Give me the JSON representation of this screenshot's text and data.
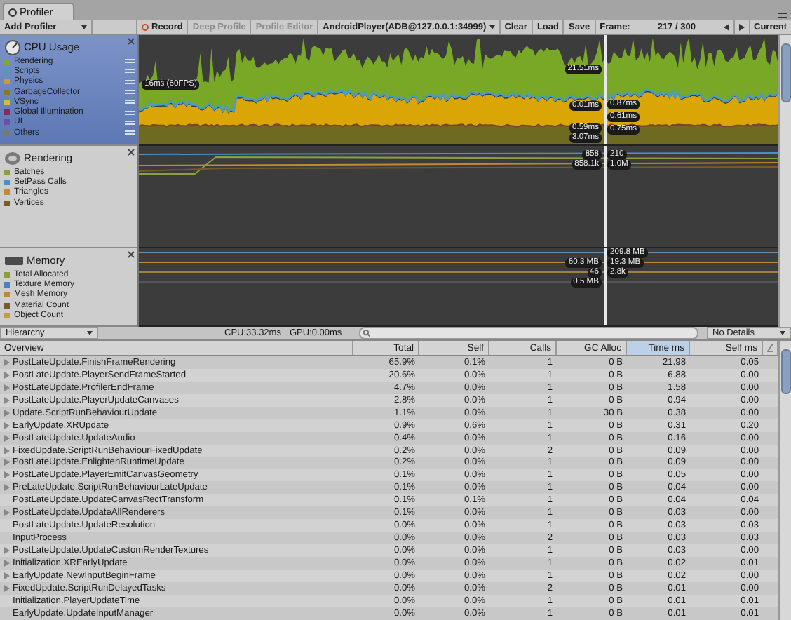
{
  "window": {
    "tab": "Profiler"
  },
  "toolbar": {
    "add_profiler": "Add Profiler",
    "buttons": [
      {
        "label": "Record",
        "kind": "record",
        "disabled": false
      },
      {
        "label": "Deep Profile",
        "kind": "plain",
        "disabled": true
      },
      {
        "label": "Profile Editor",
        "kind": "plain",
        "disabled": true
      }
    ],
    "target": "AndroidPlayer(ADB@127.0.0.1:34999)",
    "file_buttons": [
      "Clear",
      "Load",
      "Save"
    ],
    "frame_label": "Frame:",
    "frame": "217 / 300",
    "current": "Current"
  },
  "modules": [
    {
      "title": "CPU Usage",
      "kind": "cpu",
      "selected": true,
      "items": [
        {
          "label": "Rendering",
          "color": "#7fa830"
        },
        {
          "label": "Scripts",
          "color": "#4a9bc6"
        },
        {
          "label": "Physics",
          "color": "#d09a30"
        },
        {
          "label": "GarbageCollector",
          "color": "#8a7438"
        },
        {
          "label": "VSync",
          "color": "#c8c040"
        },
        {
          "label": "Global Illumination",
          "color": "#8a2a5a"
        },
        {
          "label": "UI",
          "color": "#6a50a8"
        },
        {
          "label": "Others",
          "color": "#7a7a6a"
        }
      ],
      "readouts": [
        "16ms (60FPS)",
        "21.51ms",
        "0.01ms",
        "0.87ms",
        "0.61ms",
        "0.59ms",
        "0.75ms",
        "3.07ms"
      ]
    },
    {
      "title": "Rendering",
      "kind": "rendering",
      "selected": false,
      "items": [
        {
          "label": "Batches",
          "color": "#8aa040"
        },
        {
          "label": "SetPass Calls",
          "color": "#4a90c0"
        },
        {
          "label": "Triangles",
          "color": "#c08a30"
        },
        {
          "label": "Vertices",
          "color": "#7a5a28"
        }
      ],
      "readouts": [
        "858",
        "210",
        "858.1k",
        "1.0M"
      ]
    },
    {
      "title": "Memory",
      "kind": "memory",
      "selected": false,
      "items": [
        {
          "label": "Total Allocated",
          "color": "#8aa040"
        },
        {
          "label": "Texture Memory",
          "color": "#4a80c0"
        },
        {
          "label": "Mesh Memory",
          "color": "#c08a30"
        },
        {
          "label": "Material Count",
          "color": "#7a5a28"
        },
        {
          "label": "Object Count",
          "color": "#c0a040"
        }
      ],
      "readouts": [
        "209.8 MB",
        "60.3 MB",
        "19.3 MB",
        "46",
        "2.8k",
        "0.5 MB"
      ]
    }
  ],
  "details_bar": {
    "view": "Hierarchy",
    "stats": [
      "CPU:33.32ms",
      "GPU:0.00ms"
    ],
    "details": "No Details"
  },
  "table": {
    "columns": [
      {
        "label": "Overview",
        "selected": false
      },
      {
        "label": "Total",
        "selected": false
      },
      {
        "label": "Self",
        "selected": false
      },
      {
        "label": "Calls",
        "selected": false
      },
      {
        "label": "GC Alloc",
        "selected": false
      },
      {
        "label": "Time ms",
        "selected": true
      },
      {
        "label": "Self ms",
        "selected": false
      }
    ],
    "rows": [
      {
        "name": "PostLateUpdate.FinishFrameRendering",
        "has_children": true,
        "values": [
          "65.9%",
          "0.1%",
          "1",
          "0 B",
          "21.98",
          "0.05"
        ]
      },
      {
        "name": "PostLateUpdate.PlayerSendFrameStarted",
        "has_children": true,
        "values": [
          "20.6%",
          "0.0%",
          "1",
          "0 B",
          "6.88",
          "0.00"
        ]
      },
      {
        "name": "PostLateUpdate.ProfilerEndFrame",
        "has_children": true,
        "values": [
          "4.7%",
          "0.0%",
          "1",
          "0 B",
          "1.58",
          "0.00"
        ]
      },
      {
        "name": "PostLateUpdate.PlayerUpdateCanvases",
        "has_children": true,
        "values": [
          "2.8%",
          "0.0%",
          "1",
          "0 B",
          "0.94",
          "0.00"
        ]
      },
      {
        "name": "Update.ScriptRunBehaviourUpdate",
        "has_children": true,
        "values": [
          "1.1%",
          "0.0%",
          "1",
          "30 B",
          "0.38",
          "0.00"
        ]
      },
      {
        "name": "EarlyUpdate.XRUpdate",
        "has_children": true,
        "values": [
          "0.9%",
          "0.6%",
          "1",
          "0 B",
          "0.31",
          "0.20"
        ]
      },
      {
        "name": "PostLateUpdate.UpdateAudio",
        "has_children": true,
        "values": [
          "0.4%",
          "0.0%",
          "1",
          "0 B",
          "0.16",
          "0.00"
        ]
      },
      {
        "name": "FixedUpdate.ScriptRunBehaviourFixedUpdate",
        "has_children": true,
        "values": [
          "0.2%",
          "0.0%",
          "2",
          "0 B",
          "0.09",
          "0.00"
        ]
      },
      {
        "name": "PostLateUpdate.EnlightenRuntimeUpdate",
        "has_children": true,
        "values": [
          "0.2%",
          "0.0%",
          "1",
          "0 B",
          "0.09",
          "0.00"
        ]
      },
      {
        "name": "PostLateUpdate.PlayerEmitCanvasGeometry",
        "has_children": true,
        "values": [
          "0.1%",
          "0.0%",
          "1",
          "0 B",
          "0.05",
          "0.00"
        ]
      },
      {
        "name": "PreLateUpdate.ScriptRunBehaviourLateUpdate",
        "has_children": true,
        "values": [
          "0.1%",
          "0.0%",
          "1",
          "0 B",
          "0.04",
          "0.00"
        ]
      },
      {
        "name": "PostLateUpdate.UpdateCanvasRectTransform",
        "has_children": false,
        "values": [
          "0.1%",
          "0.1%",
          "1",
          "0 B",
          "0.04",
          "0.04"
        ]
      },
      {
        "name": "PostLateUpdate.UpdateAllRenderers",
        "has_children": true,
        "values": [
          "0.1%",
          "0.0%",
          "1",
          "0 B",
          "0.03",
          "0.00"
        ]
      },
      {
        "name": "PostLateUpdate.UpdateResolution",
        "has_children": false,
        "values": [
          "0.0%",
          "0.0%",
          "1",
          "0 B",
          "0.03",
          "0.03"
        ]
      },
      {
        "name": "InputProcess",
        "has_children": false,
        "values": [
          "0.0%",
          "0.0%",
          "2",
          "0 B",
          "0.03",
          "0.03"
        ]
      },
      {
        "name": "PostLateUpdate.UpdateCustomRenderTextures",
        "has_children": true,
        "values": [
          "0.0%",
          "0.0%",
          "1",
          "0 B",
          "0.03",
          "0.00"
        ]
      },
      {
        "name": "Initialization.XREarlyUpdate",
        "has_children": true,
        "values": [
          "0.0%",
          "0.0%",
          "1",
          "0 B",
          "0.02",
          "0.01"
        ]
      },
      {
        "name": "EarlyUpdate.NewInputBeginFrame",
        "has_children": true,
        "values": [
          "0.0%",
          "0.0%",
          "1",
          "0 B",
          "0.02",
          "0.00"
        ]
      },
      {
        "name": "FixedUpdate.ScriptRunDelayedTasks",
        "has_children": true,
        "values": [
          "0.0%",
          "0.0%",
          "2",
          "0 B",
          "0.01",
          "0.00"
        ]
      },
      {
        "name": "Initialization.PlayerUpdateTime",
        "has_children": false,
        "values": [
          "0.0%",
          "0.0%",
          "1",
          "0 B",
          "0.01",
          "0.01"
        ]
      },
      {
        "name": "EarlyUpdate.UpdateInputManager",
        "has_children": false,
        "values": [
          "0.0%",
          "0.0%",
          "1",
          "0 B",
          "0.01",
          "0.01"
        ]
      }
    ]
  }
}
